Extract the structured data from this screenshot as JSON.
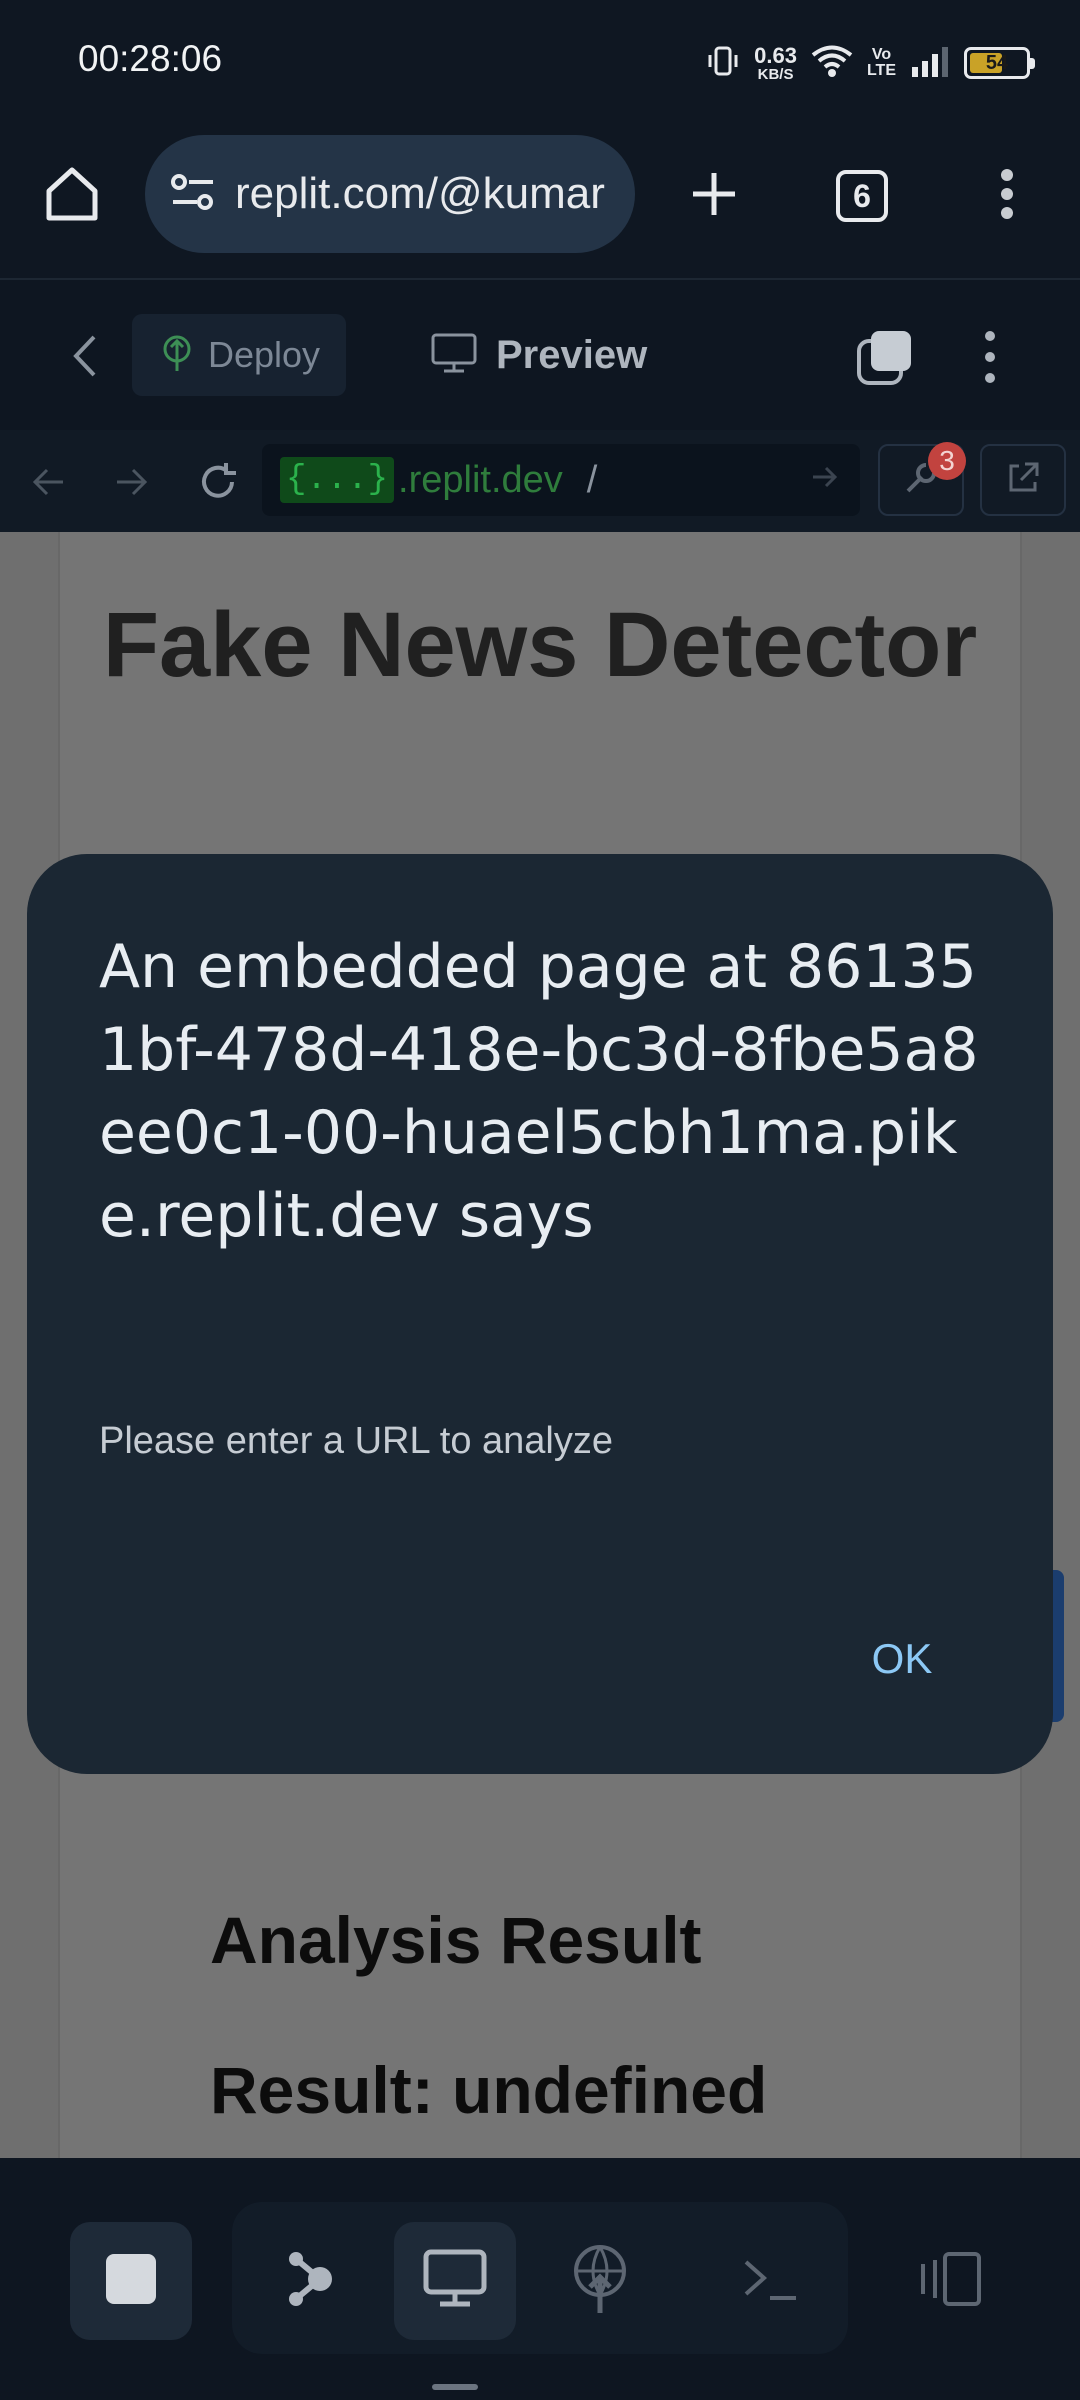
{
  "status_bar": {
    "time": "00:28:06",
    "net_speed_value": "0.63",
    "net_speed_unit": "KB/S",
    "volte_top": "Vo",
    "volte_bottom": "LTE",
    "battery_level": "54"
  },
  "browser": {
    "url": "replit.com/@kumar",
    "tab_count": "6"
  },
  "replit_header": {
    "deploy_label": "Deploy",
    "preview_label": "Preview"
  },
  "replit_address": {
    "badge": "{...}",
    "host": ".replit.dev",
    "path": "/",
    "notification_count": "3"
  },
  "page": {
    "title": "Fake News Detector",
    "result_heading": "Analysis Result",
    "result_line": "Result: undefined"
  },
  "dialog": {
    "title": "An embedded page at 861351bf-478d-418e-bc3d-8fbe5a8ee0c1-00-huael5cbh1ma.pike.replit.dev says",
    "message": "Please enter a URL to analyze",
    "ok_label": "OK"
  },
  "colors": {
    "dialog_bg": "#1b2733",
    "accent_link": "#8cc8f5",
    "page_bg": "#0e1621",
    "badge_red": "#c2433f"
  }
}
